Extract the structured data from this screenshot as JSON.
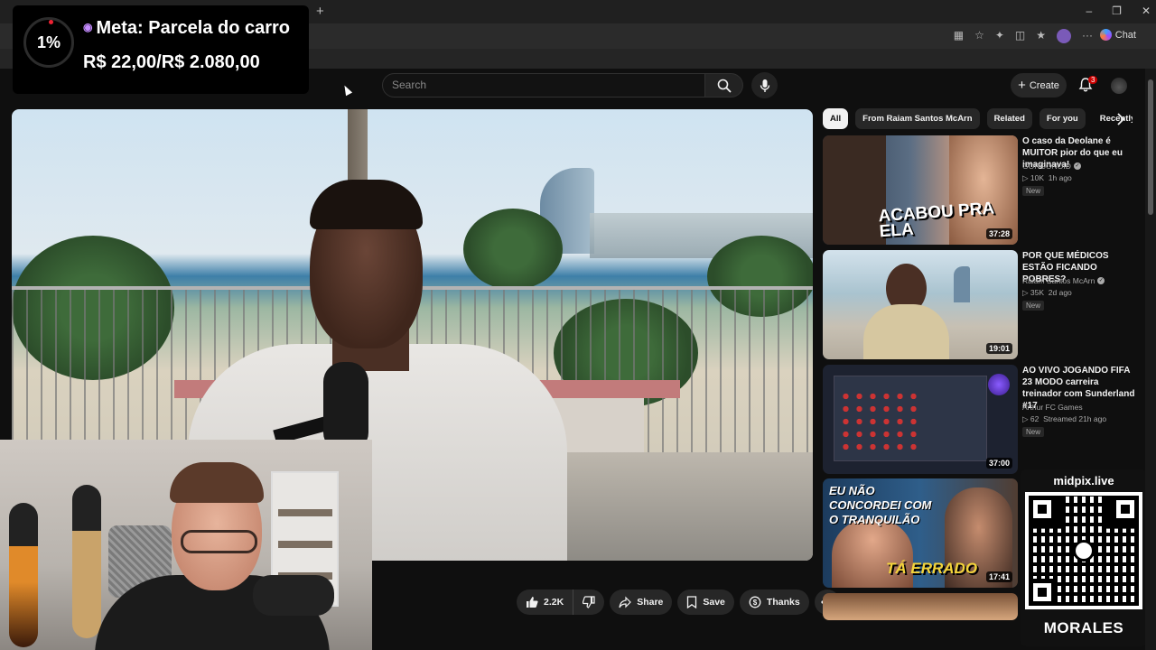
{
  "browser": {
    "new_tab_label": "+",
    "chat_label": "Chat"
  },
  "header": {
    "search_placeholder": "Search",
    "create_label": "Create",
    "notifications_count": "3"
  },
  "meta_overlay": {
    "percent": "1%",
    "title": "Meta: Parcela do carro",
    "amount": "R$ 22,00/R$ 2.080,00"
  },
  "actions": {
    "like_count": "2.2K",
    "share_label": "Share",
    "save_label": "Save",
    "thanks_label": "Thanks"
  },
  "chips": [
    "All",
    "From Raiam Santos McArn",
    "Related",
    "For you",
    "Recently"
  ],
  "recommendations": [
    {
      "title": "O caso da Deolane é MUITOR pior do que eu imaginava!",
      "channel": "GORGONOID",
      "verified": true,
      "views": "10K",
      "age": "1h ago",
      "badge": "New",
      "duration": "37:28",
      "thumb_text": "ACABOU PRA ELA"
    },
    {
      "title": "POR QUE MÉDICOS ESTÃO FICANDO POBRES?",
      "channel": "Raiam Santos McArn",
      "verified": true,
      "views": "35K",
      "age": "2d ago",
      "badge": "New",
      "duration": "19:01",
      "thumb_text": ""
    },
    {
      "title": "AO VIVO JOGANDO FIFA 23 MODO carreira treinador com Sunderland #17",
      "channel": "Arthur FC Games",
      "verified": false,
      "views": "62",
      "age": "Streamed 21h ago",
      "badge": "New",
      "duration": "37:00",
      "thumb_text": ""
    },
    {
      "title": "",
      "channel": "",
      "verified": false,
      "views": "",
      "age": "",
      "badge": "",
      "duration": "17:41",
      "thumb_text": "EU NÃO CONCORDEI COM O TRANQUILÃO",
      "thumb_text2": "TÁ ERRADO"
    }
  ],
  "qr_overlay": {
    "label": "midpix.live",
    "brand": "MORALES"
  },
  "icons": {
    "search": "search-icon",
    "mic": "mic-icon",
    "bell": "bell-icon",
    "like": "like-icon",
    "dislike": "dislike-icon",
    "share": "share-icon",
    "save": "save-icon",
    "thanks": "thanks-icon",
    "more": "more-icon",
    "chevron": "chevron-right-icon"
  }
}
